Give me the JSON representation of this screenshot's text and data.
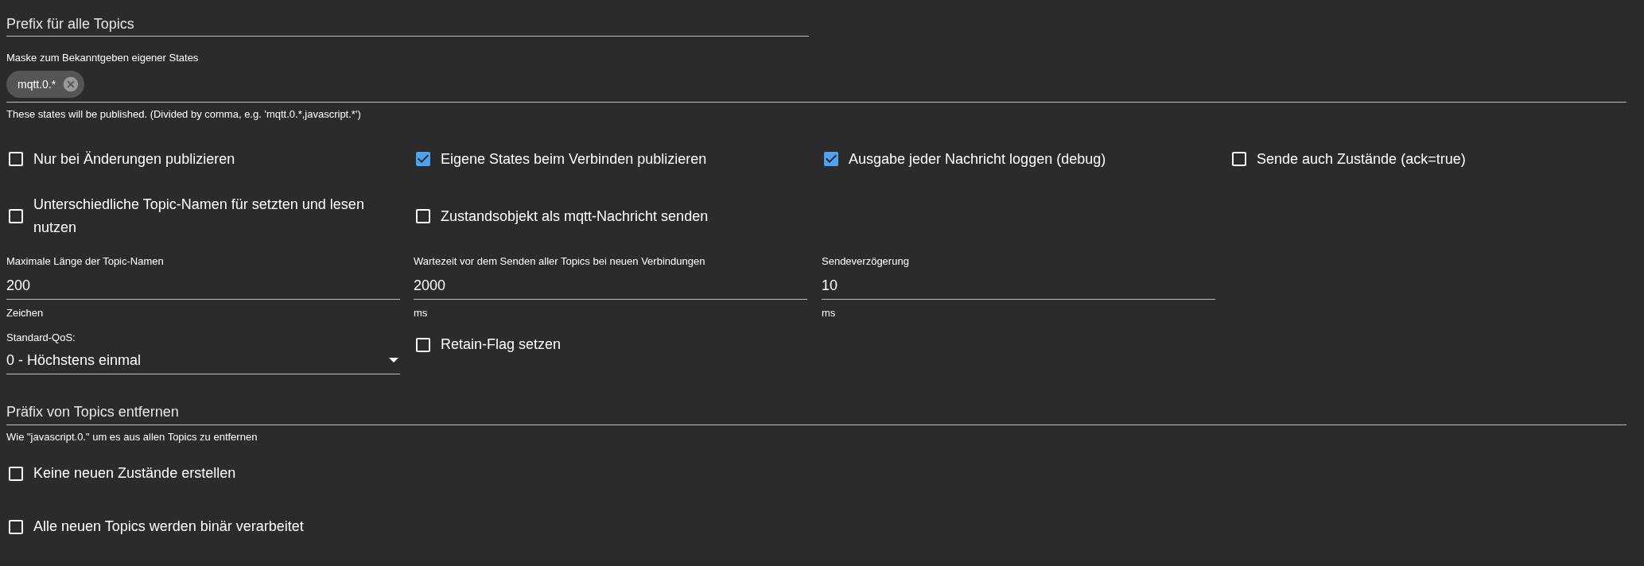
{
  "prefix_field": {
    "placeholder": "Prefix für alle Topics"
  },
  "mask_field": {
    "label": "Maske zum Bekanntgeben eigener States",
    "chips": [
      {
        "label": "mqtt.0.*"
      }
    ],
    "helper": "These states will be published. (Divided by comma, e.g. 'mqtt.0.*,javascript.*')"
  },
  "checkbox_rows": [
    [
      {
        "label": "Nur bei Änderungen publizieren",
        "checked": false
      },
      {
        "label": "Eigene States beim Verbinden publizieren",
        "checked": true
      },
      {
        "label": "Ausgabe jeder Nachricht loggen (debug)",
        "checked": true
      },
      {
        "label": "Sende auch Zustände (ack=true)",
        "checked": false
      }
    ],
    [
      {
        "label": "Unterschiedliche Topic-Namen für setzten und lesen nutzen",
        "checked": false
      },
      {
        "label": "Zustandsobjekt als mqtt-Nachricht senden",
        "checked": false
      }
    ]
  ],
  "number_fields": [
    {
      "label": "Maximale Länge der Topic-Namen",
      "value": "200",
      "helper": "Zeichen"
    },
    {
      "label": "Wartezeit vor dem Senden aller Topics bei neuen Verbindungen",
      "value": "2000",
      "helper": "ms"
    },
    {
      "label": "Sendeverzögerung",
      "value": "10",
      "helper": "ms"
    }
  ],
  "qos_select": {
    "label": "Standard-QoS:",
    "value": "0 - Höchstens einmal"
  },
  "retain_checkbox": {
    "label": "Retain-Flag setzen",
    "checked": false
  },
  "remove_prefix_field": {
    "placeholder": "Präfix von Topics entfernen",
    "helper": "Wie \"javascript.0.\" um es aus allen Topics zu entfernen"
  },
  "bottom_checkboxes": [
    {
      "label": "Keine neuen Zustände erstellen",
      "checked": false
    },
    {
      "label": "Alle neuen Topics werden binär verarbeitet",
      "checked": false
    }
  ]
}
